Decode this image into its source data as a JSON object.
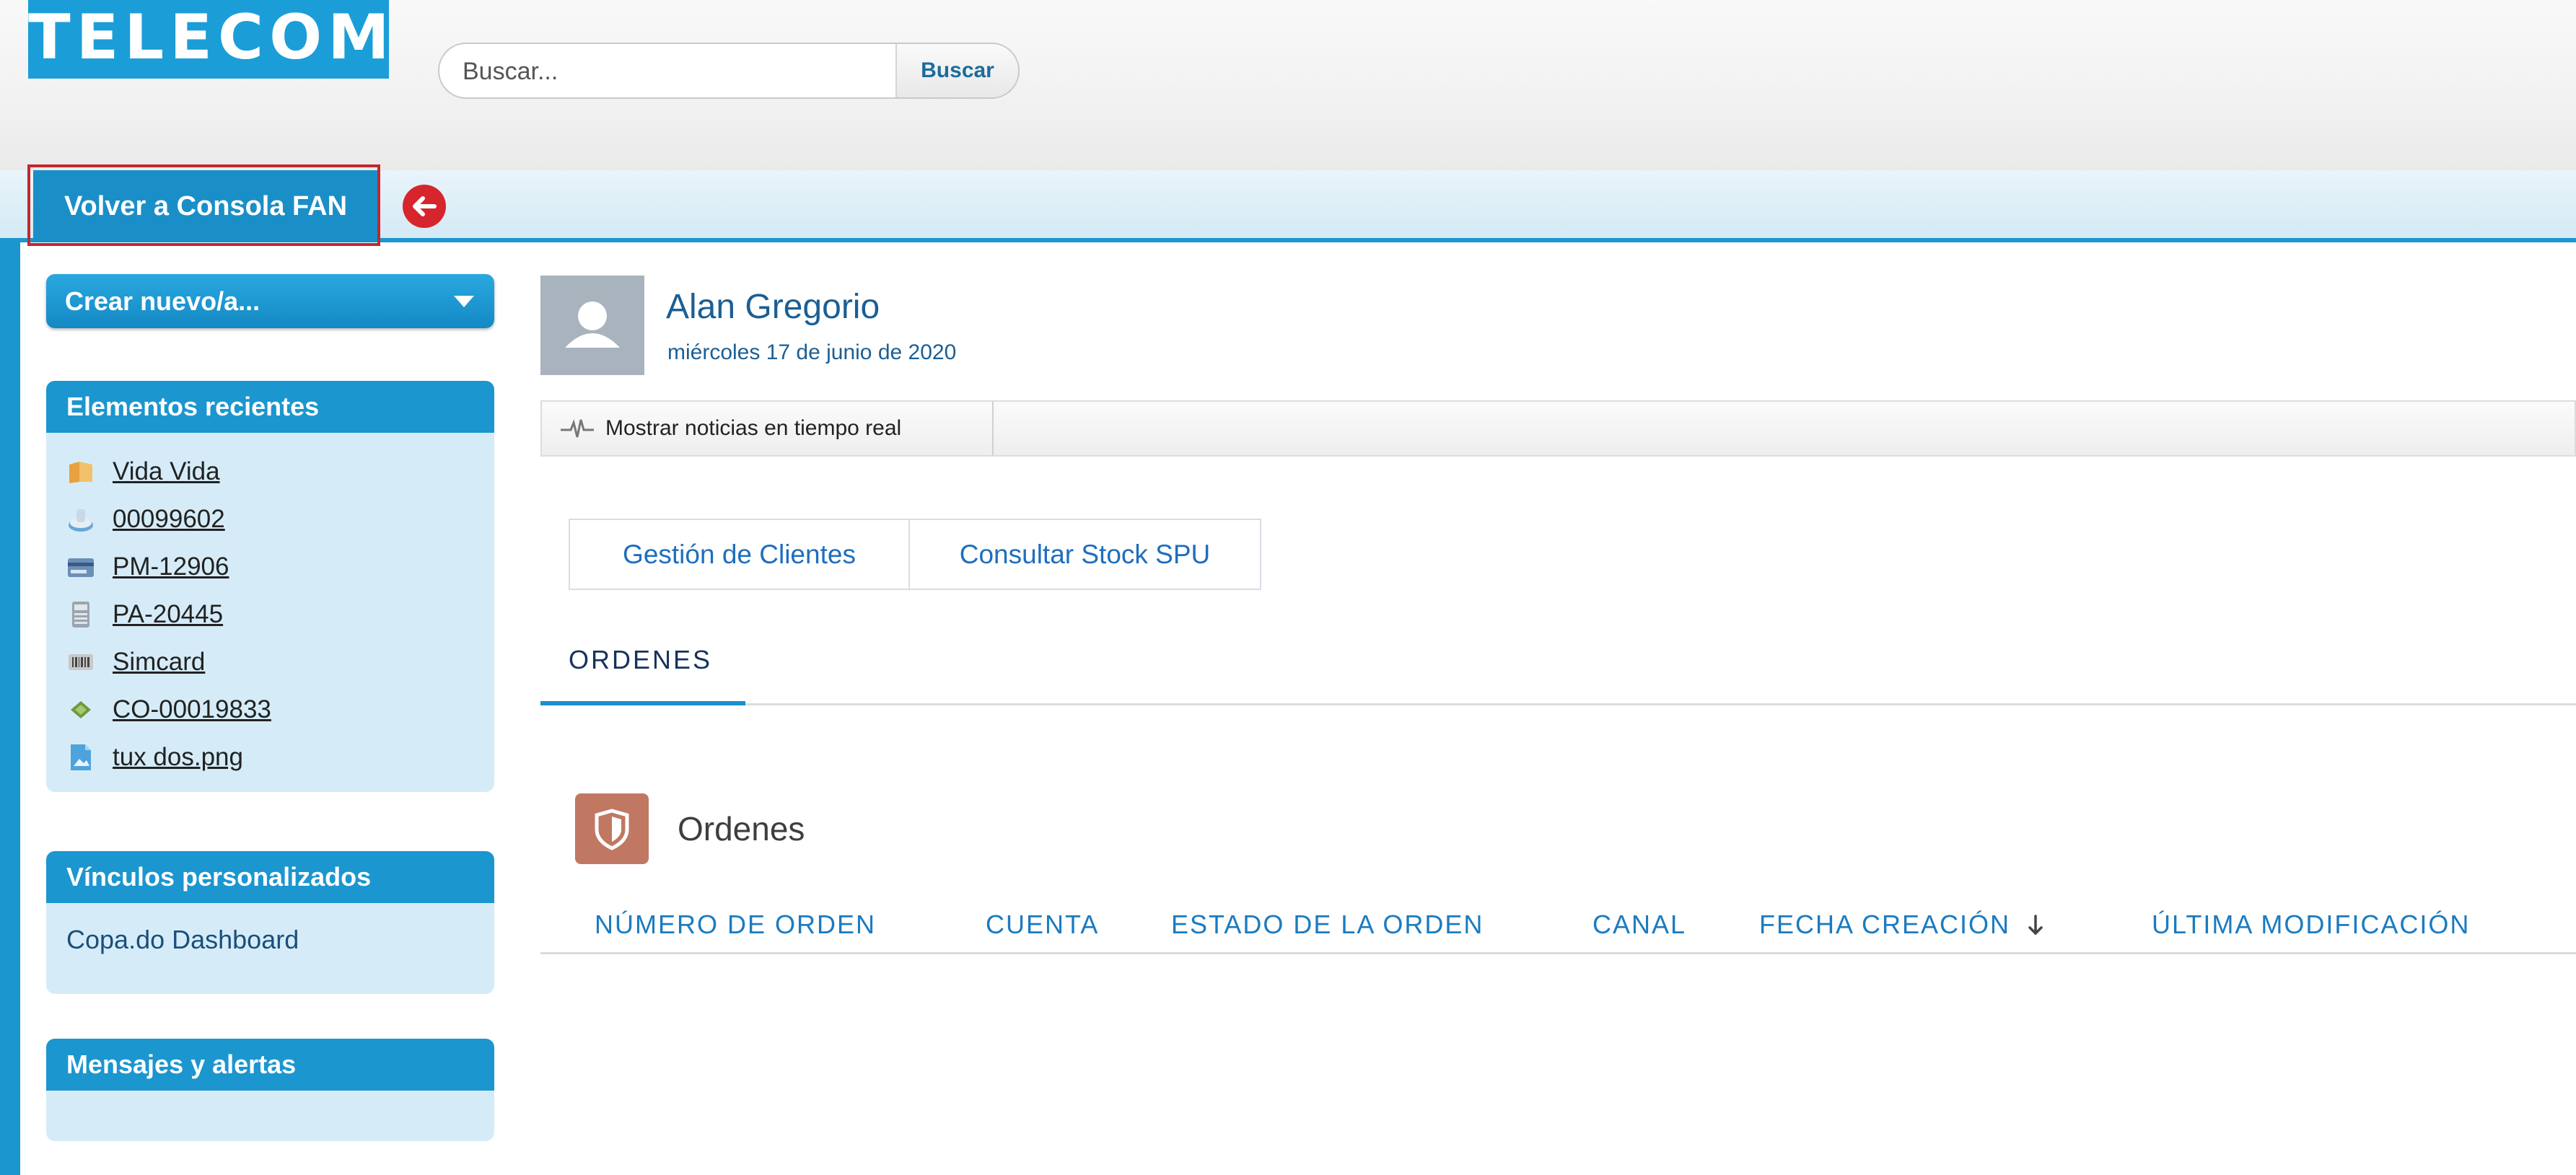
{
  "header": {
    "logo": "TELECOM",
    "search_placeholder": "Buscar...",
    "search_button": "Buscar"
  },
  "tabs": {
    "console_tab": "Volver a Consola FAN"
  },
  "sidebar": {
    "create_new": "Crear nuevo/a...",
    "recent_title": "Elementos recientes",
    "recent_items": [
      {
        "label": "Vida Vida",
        "icon": "folder-icon"
      },
      {
        "label": "00099602",
        "icon": "case-icon"
      },
      {
        "label": "PM-12906",
        "icon": "payment-card-icon"
      },
      {
        "label": "PA-20445",
        "icon": "calculator-icon"
      },
      {
        "label": "Simcard",
        "icon": "barcode-icon"
      },
      {
        "label": "CO-00019833",
        "icon": "chip-icon"
      },
      {
        "label": "tux dos.png",
        "icon": "image-file-icon"
      }
    ],
    "links_title": "Vínculos personalizados",
    "links": [
      "Copa.do Dashboard"
    ],
    "messages_title": "Mensajes y alertas"
  },
  "profile": {
    "name": "Alan Gregorio",
    "date": "miércoles 17 de junio de 2020"
  },
  "news": {
    "label": "Mostrar noticias en tiempo real"
  },
  "actions": [
    "Gestión de Clientes",
    "Consultar Stock SPU"
  ],
  "section": {
    "tab": "ORDENES"
  },
  "orders": {
    "title": "Ordenes",
    "columns": [
      "NÚMERO DE ORDEN",
      "CUENTA",
      "ESTADO DE LA ORDEN",
      "CANAL",
      "FECHA CREACIÓN",
      "ÚLTIMA MODIFICACIÓN"
    ],
    "sort_column": "FECHA CREACIÓN",
    "sort_direction": "descending"
  },
  "colors": {
    "brand_blue": "#1b96cf",
    "highlight_red": "#c2272d",
    "link_blue": "#1b7bc0",
    "orders_icon": "#c07862"
  }
}
